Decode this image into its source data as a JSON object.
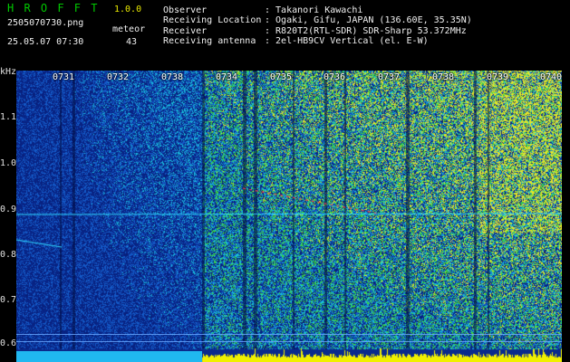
{
  "header": {
    "brand": "H R O F F T",
    "version": "1.0.0",
    "filename": "2505070730.png",
    "datetime": "25.05.07 07:30",
    "meteor_label": "meteor",
    "meteor_count": "43",
    "info": [
      {
        "label": "Observer",
        "value": ": Takanori Kawachi"
      },
      {
        "label": "Receiving Location",
        "value": ": Ogaki, Gifu, JAPAN (136.60E, 35.35N)"
      },
      {
        "label": "Receiver",
        "value": ": R820T2(RTL-SDR) SDR-Sharp 53.372MHz"
      },
      {
        "label": "Receiving antenna",
        "value": ": 2el-HB9CV Vertical (el. E-W)"
      }
    ]
  },
  "spectrogram": {
    "unit": "kHz",
    "time_ticks": [
      "0731",
      "0732",
      "0738",
      "0734",
      "0735",
      "0736",
      "0737",
      "0738",
      "0739",
      "0740"
    ],
    "freq_ticks": [
      "1.1",
      "1.0",
      "0.9",
      "0.8",
      "0.7",
      "0.6"
    ],
    "freq_range_khz": [
      0.585,
      1.2
    ],
    "colors": {
      "background_blue": "#0a2a8c",
      "noise_cyan": "#18c8e0",
      "noise_green": "#3cd23c",
      "noise_yellow": "#e8e820",
      "meteor_red": "#ff4040",
      "baseline_cyan": "#30d8ff",
      "power_yellow": "#f0f000",
      "power_cyan": "#20b8f0"
    }
  }
}
